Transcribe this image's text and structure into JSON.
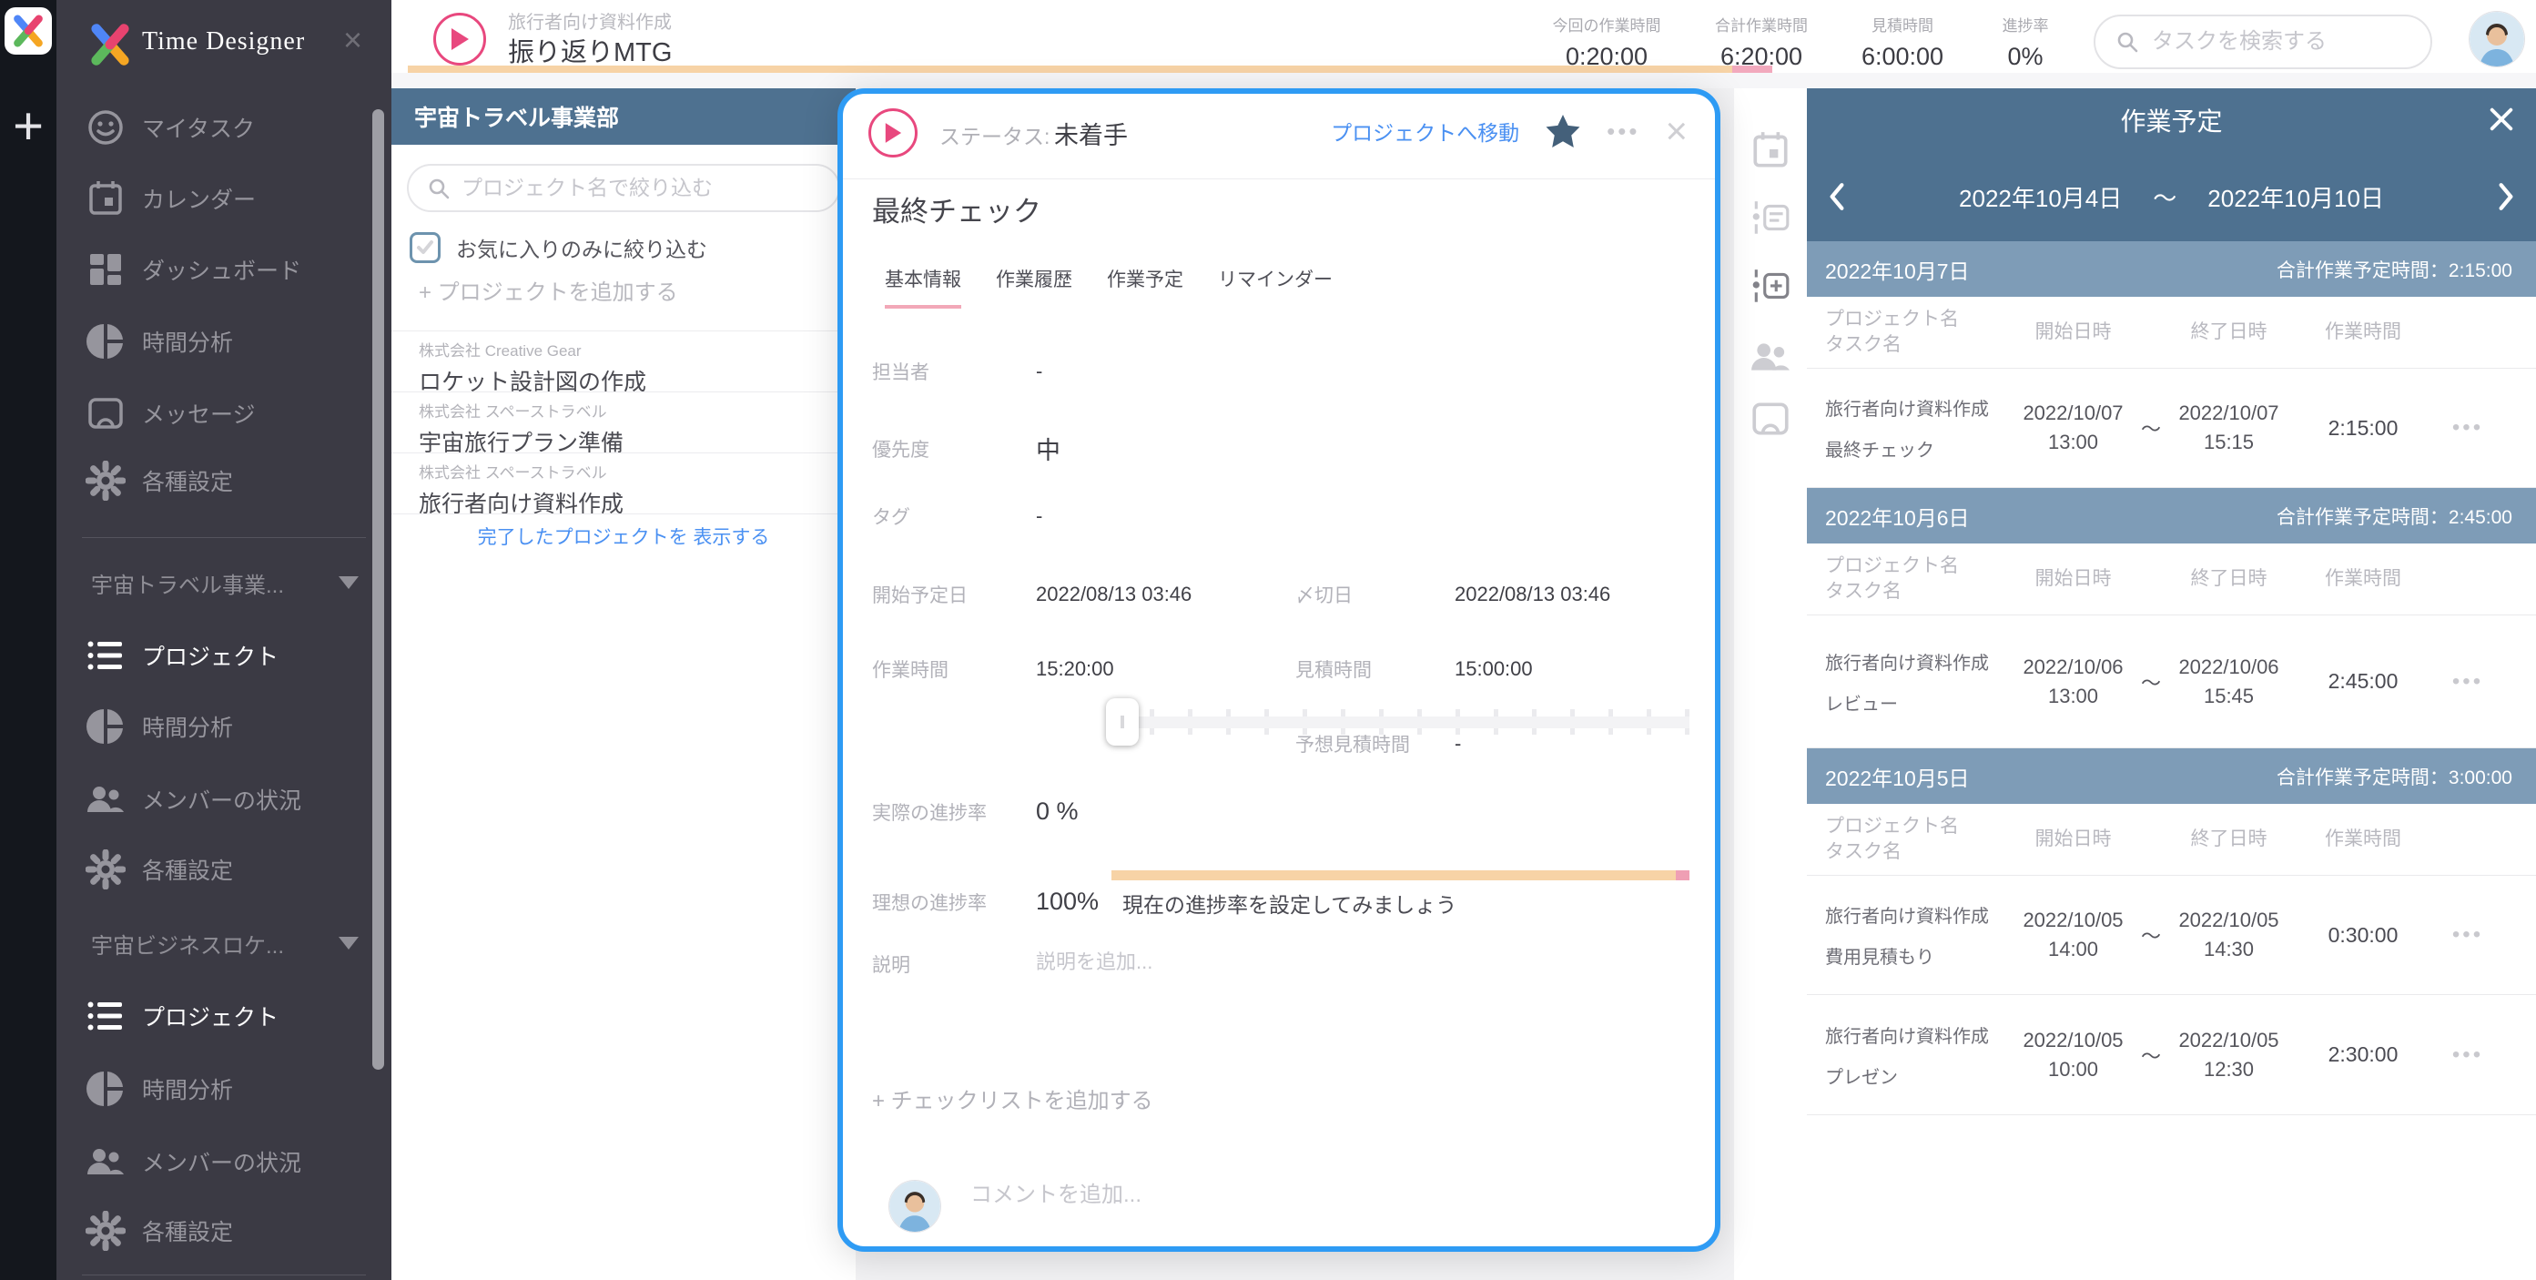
{
  "app": {
    "name": "Time Designer"
  },
  "icons": {
    "more": "•••",
    "close": "×"
  },
  "topbar": {
    "task_subtitle": "旅行者向け資料作成",
    "task_title": "振り返りMTG",
    "stats": [
      {
        "label": "今回の作業時間",
        "value": "0:20:00"
      },
      {
        "label": "合計作業時間",
        "value": "6:20:00"
      },
      {
        "label": "見積時間",
        "value": "6:00:00"
      },
      {
        "label": "進捗率",
        "value": "0%"
      }
    ],
    "search_placeholder": "タスクを検索する"
  },
  "sidebar": {
    "items": [
      "マイタスク",
      "カレンダー",
      "ダッシュボード",
      "時間分析",
      "メッセージ",
      "各種設定"
    ],
    "groups": [
      {
        "label": "宇宙トラベル事業...",
        "items": [
          "プロジェクト",
          "時間分析",
          "メンバーの状況",
          "各種設定"
        ]
      },
      {
        "label": "宇宙ビジネスロケ...",
        "items": [
          "プロジェクト",
          "時間分析",
          "メンバーの状況",
          "各種設定"
        ]
      }
    ]
  },
  "projects_panel": {
    "title": "宇宙トラベル事業部",
    "filter_placeholder": "プロジェクト名で絞り込む",
    "favorite_filter_label": "お気に入りのみに絞り込む",
    "add_project_label": "+ プロジェクトを追加する",
    "projects": [
      {
        "company": "株式会社 Creative Gear",
        "name": "ロケット設計図の作成"
      },
      {
        "company": "株式会社 スペーストラベル",
        "name": "宇宙旅行プラン準備"
      },
      {
        "company": "株式会社 スペーストラベル",
        "name": "旅行者向け資料作成"
      }
    ],
    "show_completed_label": "完了したプロジェクトを 表示する"
  },
  "task_modal": {
    "status_label": "ステータス:",
    "status_value": "未着手",
    "go_to_project_label": "プロジェクトへ移動",
    "title": "最終チェック",
    "tabs": [
      "基本情報",
      "作業履歴",
      "作業予定",
      "リマインダー"
    ],
    "assignee_label": "担当者",
    "assignee_value": "-",
    "priority_label": "優先度",
    "priority_value": "中",
    "tag_label": "タグ",
    "tag_value": "-",
    "start_label": "開始予定日",
    "start_value": "2022/08/13 03:46",
    "deadline_label": "〆切日",
    "deadline_value": "2022/08/13 03:46",
    "work_time_label": "作業時間",
    "work_time_value": "15:20:00",
    "estimate_label": "見積時間",
    "estimate_value": "15:00:00",
    "forecast_label": "予想見積時間",
    "forecast_value": "-",
    "actual_progress_label": "実際の進捗率",
    "actual_progress_value": "0 %",
    "ideal_progress_label": "理想の進捗率",
    "ideal_progress_value": "100%",
    "progress_hint": "現在の進捗率を設定してみましょう",
    "description_label": "説明",
    "description_placeholder": "説明を追加...",
    "add_checklist_label": "+ チェックリストを追加する",
    "comment_placeholder": "コメントを追加..."
  },
  "schedule_panel": {
    "title": "作業予定",
    "range_start": "2022年10月4日",
    "range_separator": "〜",
    "range_end": "2022年10月10日",
    "columns": {
      "project": "プロジェクト名",
      "task": "タスク名",
      "start": "開始日時",
      "end": "終了日時",
      "duration": "作業時間"
    },
    "groups": [
      {
        "date": "2022年10月7日",
        "total": "合計作業予定時間：2:15:00",
        "rows": [
          {
            "project": "旅行者向け資料作成",
            "task": "最終チェック",
            "start_date": "2022/10/07",
            "start_time": "13:00",
            "sep": "〜",
            "end_date": "2022/10/07",
            "end_time": "15:15",
            "duration": "2:15:00"
          }
        ]
      },
      {
        "date": "2022年10月6日",
        "total": "合計作業予定時間：2:45:00",
        "rows": [
          {
            "project": "旅行者向け資料作成",
            "task": "レビュー",
            "start_date": "2022/10/06",
            "start_time": "13:00",
            "sep": "〜",
            "end_date": "2022/10/06",
            "end_time": "15:45",
            "duration": "2:45:00"
          }
        ]
      },
      {
        "date": "2022年10月5日",
        "total": "合計作業予定時間：3:00:00",
        "rows": [
          {
            "project": "旅行者向け資料作成",
            "task": "費用見積もり",
            "start_date": "2022/10/05",
            "start_time": "14:00",
            "sep": "〜",
            "end_date": "2022/10/05",
            "end_time": "14:30",
            "duration": "0:30:00"
          },
          {
            "project": "旅行者向け資料作成",
            "task": "プレゼン",
            "start_date": "2022/10/05",
            "start_time": "10:00",
            "sep": "〜",
            "end_date": "2022/10/05",
            "end_time": "12:30",
            "duration": "2:30:00"
          }
        ]
      }
    ]
  },
  "colors": {
    "accent_pink": "#e8487e",
    "accent_blue": "#4a90f2",
    "modal_border": "#2e9bf4",
    "header_blue": "#4e7190",
    "group_blue": "#7e9cb7",
    "progress_orange": "#f7d3a6",
    "progress_pink": "#f2a9bd"
  }
}
